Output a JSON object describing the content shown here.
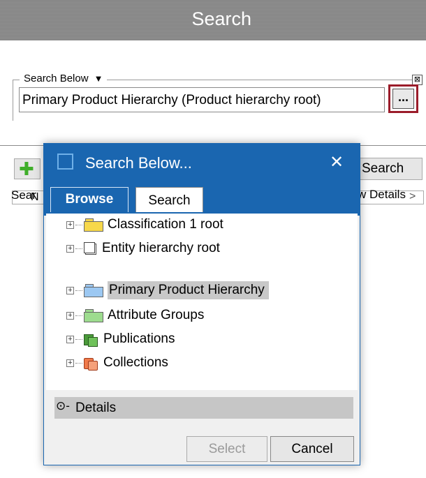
{
  "header": {
    "title": "Search"
  },
  "search_below": {
    "label": "Search Below",
    "dropdown_icon": "triangle-down-icon",
    "close_glyph": "⊠",
    "path_value": "Primary Product Hierarchy (Product hierarchy root)",
    "browse_label": "..."
  },
  "background": {
    "add_icon": "plus-icon",
    "search_button": "Search",
    "search_label_fragment": "Sear",
    "view_details_fragment": "w Details",
    "name_fragment": "N",
    "chevron": ">"
  },
  "dialog": {
    "title": "Search Below...",
    "close_glyph": "✕",
    "tabs": [
      {
        "label": "Browse",
        "active": true
      },
      {
        "label": "Search",
        "active": false
      }
    ],
    "tree": [
      {
        "label": "Classification 1 root",
        "icon": "folder-icon",
        "color": "#f7d84a"
      },
      {
        "label": "Entity hierarchy root",
        "icon": "entity-icon",
        "color": "#ffffff"
      },
      {
        "label": "Primary Product Hierarchy",
        "icon": "folder-icon",
        "color": "#9cc8f2",
        "selected": true
      },
      {
        "label": "Attribute Groups",
        "icon": "folder-icon",
        "color": "#9ddc8e"
      },
      {
        "label": "Publications",
        "icon": "publications-icon",
        "color": "#4a9a3a"
      },
      {
        "label": "Collections",
        "icon": "collections-icon",
        "color": "#f07a4a"
      }
    ],
    "details_label": "Details",
    "select_label": "Select",
    "cancel_label": "Cancel"
  },
  "colors": {
    "accent": "#1a66b0",
    "highlight_border": "#9b1c2a"
  }
}
